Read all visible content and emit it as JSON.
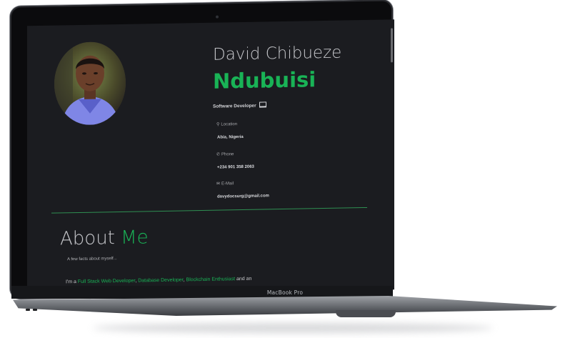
{
  "device": {
    "label": "MacBook Pro"
  },
  "profile": {
    "first_name": "David Chibueze",
    "last_name": "Ndubuisi",
    "role": "Software Developer",
    "location_label": "Location",
    "location_value": "Abia, Nigeria",
    "phone_label": "Phone",
    "phone_value": "+234 901 358 2063",
    "email_label": "E-Mail",
    "email_value": "davydocsurg@gmail.com"
  },
  "about": {
    "title_part1": "About ",
    "title_part2": "Me",
    "subtitle": "A few facts about myself...",
    "bio_prefix": "I'm a ",
    "bio_link1": "Full Stack Web Developer",
    "bio_sep1": ", ",
    "bio_link2": "Database Developer",
    "bio_sep2": ", ",
    "bio_link3": "Blockchain Enthusiast",
    "bio_suffix": " and an"
  },
  "icons": {
    "location": "map-pin-icon",
    "phone": "phone-icon",
    "email": "envelope-icon",
    "role": "laptop-icon"
  },
  "colors": {
    "accent": "#19b356",
    "background": "#1b1c20"
  }
}
